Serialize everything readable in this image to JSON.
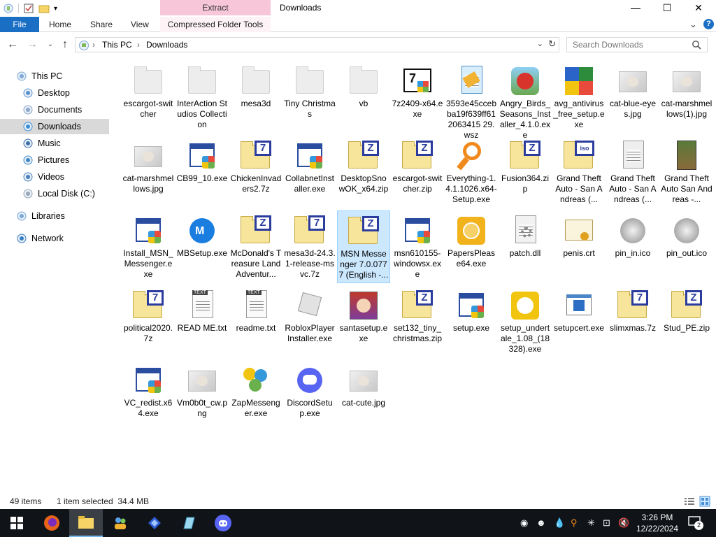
{
  "window": {
    "title": "Downloads",
    "contextual_tab_group": "Extract",
    "controls": {
      "minimize": "—",
      "maximize": "☐",
      "close": "✕"
    }
  },
  "ribbon": {
    "tabs": [
      "File",
      "Home",
      "Share",
      "View",
      "Compressed Folder Tools"
    ],
    "expand_icon": "⌄",
    "help_icon": "?"
  },
  "address": {
    "breadcrumbs": [
      "This PC",
      "Downloads"
    ],
    "separator": "›",
    "search_placeholder": "Search Downloads"
  },
  "sidebar": {
    "items": [
      {
        "label": "This PC",
        "icon": "pc-icon",
        "level": 0,
        "selected": false
      },
      {
        "label": "Desktop",
        "icon": "desktop-icon",
        "level": 1,
        "selected": false
      },
      {
        "label": "Documents",
        "icon": "documents-icon",
        "level": 1,
        "selected": false
      },
      {
        "label": "Downloads",
        "icon": "downloads-icon",
        "level": 1,
        "selected": true
      },
      {
        "label": "Music",
        "icon": "music-icon",
        "level": 1,
        "selected": false
      },
      {
        "label": "Pictures",
        "icon": "pictures-icon",
        "level": 1,
        "selected": false
      },
      {
        "label": "Videos",
        "icon": "videos-icon",
        "level": 1,
        "selected": false
      },
      {
        "label": "Local Disk (C:)",
        "icon": "disk-icon",
        "level": 1,
        "selected": false
      },
      {
        "label": "Libraries",
        "icon": "libraries-icon",
        "level": 0,
        "selected": false
      },
      {
        "label": "Network",
        "icon": "network-icon",
        "level": 0,
        "selected": false
      }
    ]
  },
  "files": [
    {
      "name": "escargot-switcher",
      "icon": "folder"
    },
    {
      "name": "InterAction Studios Collection",
      "icon": "folder"
    },
    {
      "name": "mesa3d",
      "icon": "folder"
    },
    {
      "name": "Tiny Christmas",
      "icon": "folder"
    },
    {
      "name": "vb",
      "icon": "folder"
    },
    {
      "name": "7z2409-x64.exe",
      "icon": "sevenzip-installer"
    },
    {
      "name": "3593e45ccebba19f639ff612063415 29.wsz",
      "icon": "wsz-file"
    },
    {
      "name": "Angry_Birds_Seasons_Installer_4.1.0.exe",
      "icon": "angry-birds"
    },
    {
      "name": "avg_antivirus_free_setup.exe",
      "icon": "avg"
    },
    {
      "name": "cat-blue-eyes.jpg",
      "icon": "image"
    },
    {
      "name": "cat-marshmellows(1).jpg",
      "icon": "image"
    },
    {
      "name": "cat-marshmellows.jpg",
      "icon": "image"
    },
    {
      "name": "CB99_10.exe",
      "icon": "installer"
    },
    {
      "name": "ChickenInvaders2.7z",
      "icon": "archive-7z"
    },
    {
      "name": "CollabnetInstaller.exe",
      "icon": "installer"
    },
    {
      "name": "DesktopSnowOK_x64.zip",
      "icon": "archive-zip"
    },
    {
      "name": "escargot-switcher.zip",
      "icon": "archive-zip"
    },
    {
      "name": "Everything-1.4.1.1026.x64-Setup.exe",
      "icon": "everything"
    },
    {
      "name": "Fusion364.zip",
      "icon": "archive-zip"
    },
    {
      "name": "Grand Theft Auto - San Andreas (...",
      "icon": "iso"
    },
    {
      "name": "Grand Theft Auto - San Andreas (...",
      "icon": "document"
    },
    {
      "name": "Grand Theft Auto San Andreas -...",
      "icon": "gta"
    },
    {
      "name": "Install_MSN_Messenger.exe",
      "icon": "installer"
    },
    {
      "name": "MBSetup.exe",
      "icon": "malwarebytes"
    },
    {
      "name": "McDonald's Treasure Land Adventur...",
      "icon": "archive-zip"
    },
    {
      "name": "mesa3d-24.3.1-release-msvc.7z",
      "icon": "archive-7z"
    },
    {
      "name": "MSN Messenger 7.0.0777 (English -...",
      "icon": "archive-zip",
      "selected": true
    },
    {
      "name": "msn610155-windowsx.exe",
      "icon": "installer"
    },
    {
      "name": "PapersPlease64.exe",
      "icon": "papers-please"
    },
    {
      "name": "patch.dll",
      "icon": "dll"
    },
    {
      "name": "penis.crt",
      "icon": "certificate"
    },
    {
      "name": "pin_in.ico",
      "icon": "pin"
    },
    {
      "name": "pin_out.ico",
      "icon": "pin"
    },
    {
      "name": "political2020.7z",
      "icon": "archive-7z"
    },
    {
      "name": "READ ME.txt",
      "icon": "text"
    },
    {
      "name": "readme.txt",
      "icon": "text"
    },
    {
      "name": "RobloxPlayerInstaller.exe",
      "icon": "roblox"
    },
    {
      "name": "santasetup.exe",
      "icon": "santa"
    },
    {
      "name": "set132_tiny_christmas.zip",
      "icon": "archive-zip"
    },
    {
      "name": "setup.exe",
      "icon": "installer"
    },
    {
      "name": "setup_undertale_1.08_(18328).exe",
      "icon": "undertale"
    },
    {
      "name": "setupcert.exe",
      "icon": "window-app"
    },
    {
      "name": "slimxmas.7z",
      "icon": "archive-7z"
    },
    {
      "name": "Stud_PE.zip",
      "icon": "archive-zip"
    },
    {
      "name": "VC_redist.x64.exe",
      "icon": "installer"
    },
    {
      "name": "Vm0b0t_cw.png",
      "icon": "image"
    },
    {
      "name": "ZapMessenger.exe",
      "icon": "zap"
    },
    {
      "name": "DiscordSetup.exe",
      "icon": "discord"
    },
    {
      "name": "cat-cute.jpg",
      "icon": "image"
    }
  ],
  "status": {
    "item_count": "49 items",
    "selection": "1 item selected  34.4 MB"
  },
  "taskbar": {
    "apps": [
      "start-icon",
      "firefox-icon",
      "file-explorer-icon",
      "people-app-icon",
      "vs-app-icon",
      "notepad-app-icon",
      "discord-icon"
    ],
    "time": "3:26 PM",
    "date": "12/22/2024",
    "notification_count": "2"
  },
  "colors": {
    "accent": "#1a6fc4",
    "selected_bg": "#cce8ff",
    "selected_border": "#99d1ff",
    "ribbon_context": "#f7c7d9",
    "taskbar": "#101418"
  }
}
